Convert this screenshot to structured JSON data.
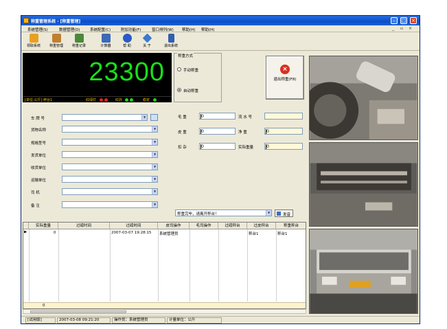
{
  "window": {
    "title": "称重管理系统 - [称重管理]"
  },
  "menu": [
    "系统管理(S)",
    "数据管理(D)",
    "系统配置(C)",
    "附加功能(F)",
    "窗口排列(W)",
    "帮助(H)",
    "帮助(H)"
  ],
  "toolbar": [
    {
      "label": "领取系统",
      "icon": "home-icon",
      "color": "#e8a020"
    },
    {
      "label": "称重管理",
      "icon": "scale-icon",
      "color": "#c08030"
    },
    {
      "label": "称重记录",
      "icon": "records-icon",
      "color": "#4a8a3a"
    },
    {
      "label": "计算器",
      "icon": "calculator-icon",
      "color": "#3a6ab8"
    },
    {
      "label": "帮 助",
      "icon": "help-icon",
      "color": "#2a5ac8"
    },
    {
      "label": "关 于",
      "icon": "info-icon",
      "color": "#3a7ad0"
    },
    {
      "label": "退出系统",
      "icon": "exit-door-icon",
      "color": "#3060b0"
    }
  ],
  "scale": {
    "reading": "23300",
    "unit_label": "[单位:公斤] 秤台1",
    "red_light_label": "红绿灯",
    "light1_label": "红外",
    "light2_label": "稳定",
    "colors": {
      "led": "#18e018",
      "red": "#e02020",
      "green": "#20d020"
    }
  },
  "mode": {
    "legend": "称重方式",
    "manual": "手动称重",
    "auto": "自动称重",
    "selected": "auto"
  },
  "exit_button": {
    "label": "退出称重(F8)"
  },
  "left_fields": [
    {
      "label": "车 牌 号"
    },
    {
      "label": "货物名称"
    },
    {
      "label": "规格型号"
    },
    {
      "label": "发货单位"
    },
    {
      "label": "收货单位"
    },
    {
      "label": "运输单位"
    },
    {
      "label": "司    机"
    },
    {
      "label": "备    注"
    }
  ],
  "weights": {
    "gross_label": "毛    重",
    "gross_value": "0",
    "serial_label": "流 水 号",
    "serial_value": "",
    "tare_label": "皮    重",
    "tare_value": "0",
    "net_label": "净    重",
    "net_value": "0",
    "deduct_label": "扣    杂",
    "deduct_value": "0",
    "actual_label": "实际重量",
    "actual_value": "0"
  },
  "message": {
    "text": "称重完毕，请离开秤台！",
    "send_label": "发音"
  },
  "grid": {
    "columns": [
      "实际重量",
      "过磅时间",
      "过磅时间",
      "皮司操作",
      "毛司操作",
      "过磅秤台",
      "过皮秤台",
      "称重秤台"
    ],
    "rows": [
      [
        "0",
        "",
        "2007-03-07 19:28:15",
        "系统管理员",
        "",
        "",
        "秤台1",
        "秤台1"
      ]
    ],
    "footer_total": "0"
  },
  "status": {
    "mode": "[试用版]",
    "datetime": "2007-03-08 09:21:20",
    "operator": "操作员：系统管理员",
    "unit": "计量单位：公斤"
  }
}
